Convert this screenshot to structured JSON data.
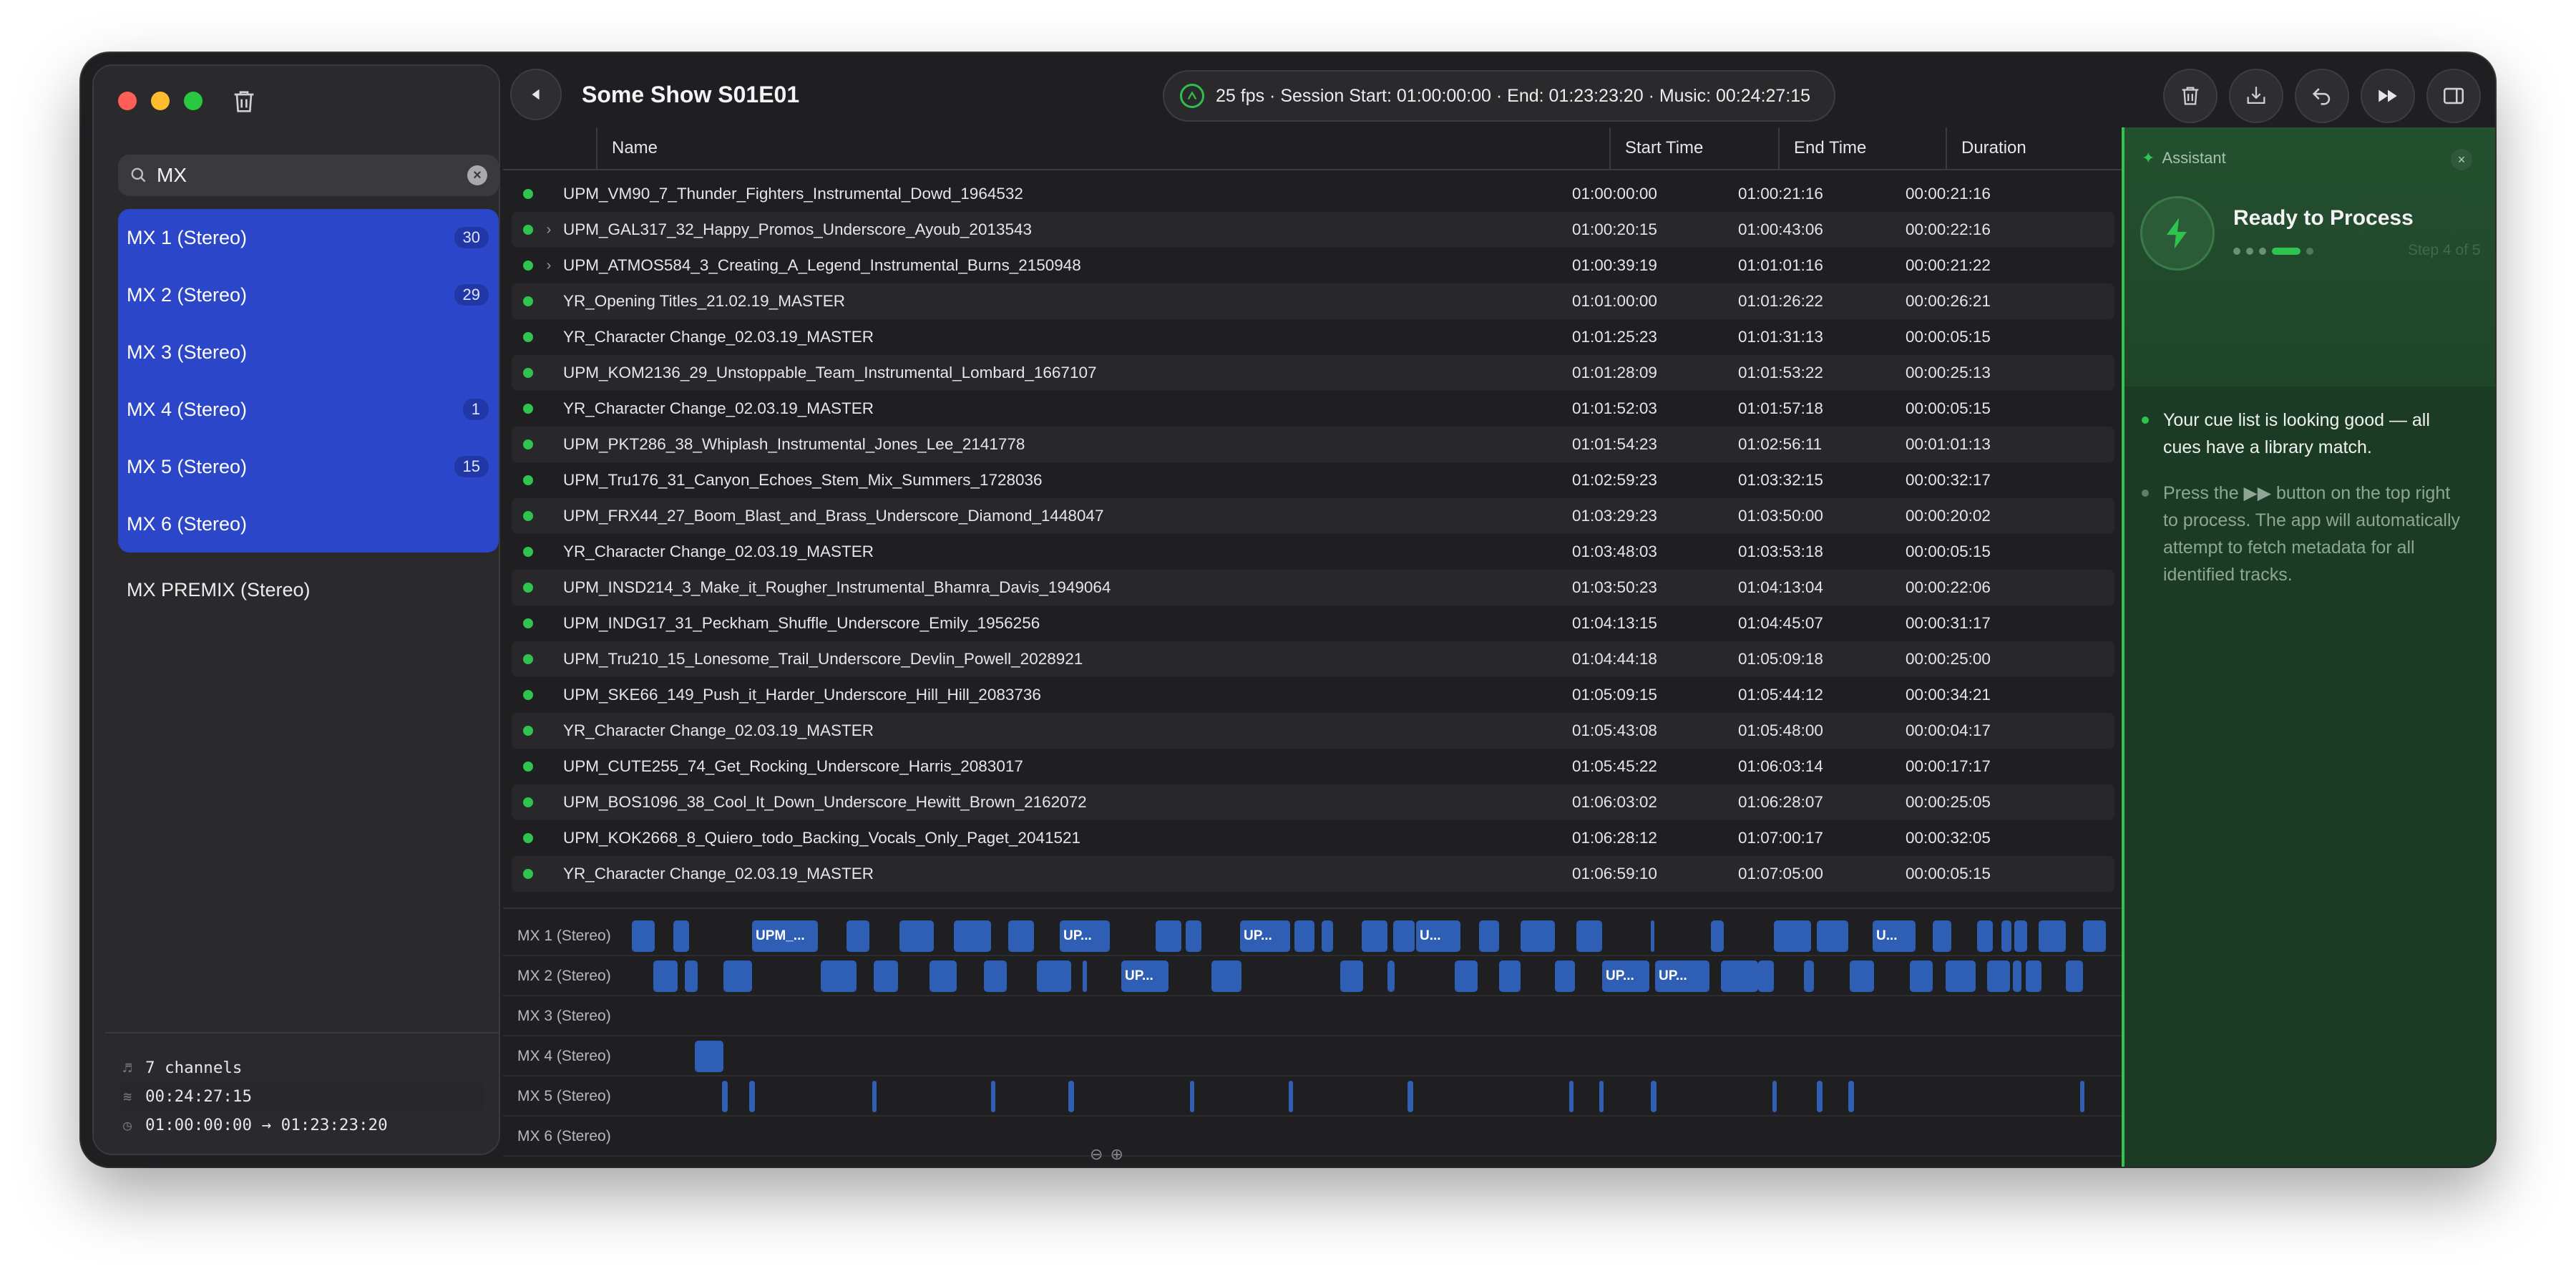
{
  "sidebar": {
    "search_value": "MX",
    "channels": [
      {
        "label": "MX 1 (Stereo)",
        "badge": "30"
      },
      {
        "label": "MX 2 (Stereo)",
        "badge": "29"
      },
      {
        "label": "MX 3 (Stereo)",
        "badge": ""
      },
      {
        "label": "MX 4 (Stereo)",
        "badge": "1"
      },
      {
        "label": "MX 5 (Stereo)",
        "badge": "15"
      },
      {
        "label": "MX 6 (Stereo)",
        "badge": ""
      }
    ],
    "extra_channel": "MX PREMIX (Stereo)",
    "footer": {
      "channels": "7 channels",
      "duration": "00:24:27:15",
      "range": "01:00:00:00 → 01:23:23:20"
    }
  },
  "header": {
    "title": "Some Show S01E01",
    "session": "25 fps · Session Start: 01:00:00:00 · End: 01:23:23:20 · Music: 00:24:27:15"
  },
  "table": {
    "columns": {
      "name": "Name",
      "start": "Start Time",
      "end": "End Time",
      "duration": "Duration"
    },
    "rows": [
      {
        "name": "UPM_VM90_7_Thunder_Fighters_Instrumental_Dowd_1964532",
        "start": "01:00:00:00",
        "end": "01:00:21:16",
        "duration": "00:00:21:16",
        "expand": ""
      },
      {
        "name": "UPM_GAL317_32_Happy_Promos_Underscore_Ayoub_2013543",
        "start": "01:00:20:15",
        "end": "01:00:43:06",
        "duration": "00:00:22:16",
        "expand": "›"
      },
      {
        "name": "UPM_ATMOS584_3_Creating_A_Legend_Instrumental_Burns_2150948",
        "start": "01:00:39:19",
        "end": "01:01:01:16",
        "duration": "00:00:21:22",
        "expand": "›"
      },
      {
        "name": "YR_Opening Titles_21.02.19_MASTER",
        "start": "01:01:00:00",
        "end": "01:01:26:22",
        "duration": "00:00:26:21",
        "expand": ""
      },
      {
        "name": "YR_Character Change_02.03.19_MASTER",
        "start": "01:01:25:23",
        "end": "01:01:31:13",
        "duration": "00:00:05:15",
        "expand": ""
      },
      {
        "name": "UPM_KOM2136_29_Unstoppable_Team_Instrumental_Lombard_1667107",
        "start": "01:01:28:09",
        "end": "01:01:53:22",
        "duration": "00:00:25:13",
        "expand": ""
      },
      {
        "name": "YR_Character Change_02.03.19_MASTER",
        "start": "01:01:52:03",
        "end": "01:01:57:18",
        "duration": "00:00:05:15",
        "expand": ""
      },
      {
        "name": "UPM_PKT286_38_Whiplash_Instrumental_Jones_Lee_2141778",
        "start": "01:01:54:23",
        "end": "01:02:56:11",
        "duration": "00:01:01:13",
        "expand": ""
      },
      {
        "name": "UPM_Tru176_31_Canyon_Echoes_Stem_Mix_Summers_1728036",
        "start": "01:02:59:23",
        "end": "01:03:32:15",
        "duration": "00:00:32:17",
        "expand": ""
      },
      {
        "name": "UPM_FRX44_27_Boom_Blast_and_Brass_Underscore_Diamond_1448047",
        "start": "01:03:29:23",
        "end": "01:03:50:00",
        "duration": "00:00:20:02",
        "expand": ""
      },
      {
        "name": "YR_Character Change_02.03.19_MASTER",
        "start": "01:03:48:03",
        "end": "01:03:53:18",
        "duration": "00:00:05:15",
        "expand": ""
      },
      {
        "name": "UPM_INSD214_3_Make_it_Rougher_Instrumental_Bhamra_Davis_1949064",
        "start": "01:03:50:23",
        "end": "01:04:13:04",
        "duration": "00:00:22:06",
        "expand": ""
      },
      {
        "name": "UPM_INDG17_31_Peckham_Shuffle_Underscore_Emily_1956256",
        "start": "01:04:13:15",
        "end": "01:04:45:07",
        "duration": "00:00:31:17",
        "expand": ""
      },
      {
        "name": "UPM_Tru210_15_Lonesome_Trail_Underscore_Devlin_Powell_2028921",
        "start": "01:04:44:18",
        "end": "01:05:09:18",
        "duration": "00:00:25:00",
        "expand": ""
      },
      {
        "name": "UPM_SKE66_149_Push_it_Harder_Underscore_Hill_Hill_2083736",
        "start": "01:05:09:15",
        "end": "01:05:44:12",
        "duration": "00:00:34:21",
        "expand": ""
      },
      {
        "name": "YR_Character Change_02.03.19_MASTER",
        "start": "01:05:43:08",
        "end": "01:05:48:00",
        "duration": "00:00:04:17",
        "expand": ""
      },
      {
        "name": "UPM_CUTE255_74_Get_Rocking_Underscore_Harris_2083017",
        "start": "01:05:45:22",
        "end": "01:06:03:14",
        "duration": "00:00:17:17",
        "expand": ""
      },
      {
        "name": "UPM_BOS1096_38_Cool_It_Down_Underscore_Hewitt_Brown_2162072",
        "start": "01:06:03:02",
        "end": "01:06:28:07",
        "duration": "00:00:25:05",
        "expand": ""
      },
      {
        "name": "UPM_KOK2668_8_Quiero_todo_Backing_Vocals_Only_Paget_2041521",
        "start": "01:06:28:12",
        "end": "01:07:00:17",
        "duration": "00:00:32:05",
        "expand": ""
      },
      {
        "name": "YR_Character Change_02.03.19_MASTER",
        "start": "01:06:59:10",
        "end": "01:07:05:00",
        "duration": "00:00:05:15",
        "expand": ""
      }
    ]
  },
  "timeline": {
    "lanes": [
      "MX 1 (Stereo)",
      "MX 2 (Stereo)",
      "MX 3 (Stereo)",
      "MX 4 (Stereo)",
      "MX 5 (Stereo)",
      "MX 6 (Stereo)"
    ],
    "clip_labels": {
      "mx1_a": "UPM_...",
      "mx1_b": "UP...",
      "mx1_c": "UP...",
      "mx1_d": "U...",
      "mx1_e": "U...",
      "mx2_a": "UP...",
      "mx2_b": "UP...",
      "mx2_c": "UP..."
    }
  },
  "assistant": {
    "header": "Assistant",
    "title": "Ready to Process",
    "step": "Step 4 of 5",
    "messages": [
      "Your cue list is looking good — all cues have a library match.",
      "Press the ▶▶ button on the top right to process. The app will automatically attempt to fetch metadata for all identified tracks."
    ]
  },
  "colors": {
    "accent": "#2b46c9",
    "clip": "#2e5fb5",
    "status_green": "#2ec44f",
    "assistant_bg": "#1c3b25"
  }
}
